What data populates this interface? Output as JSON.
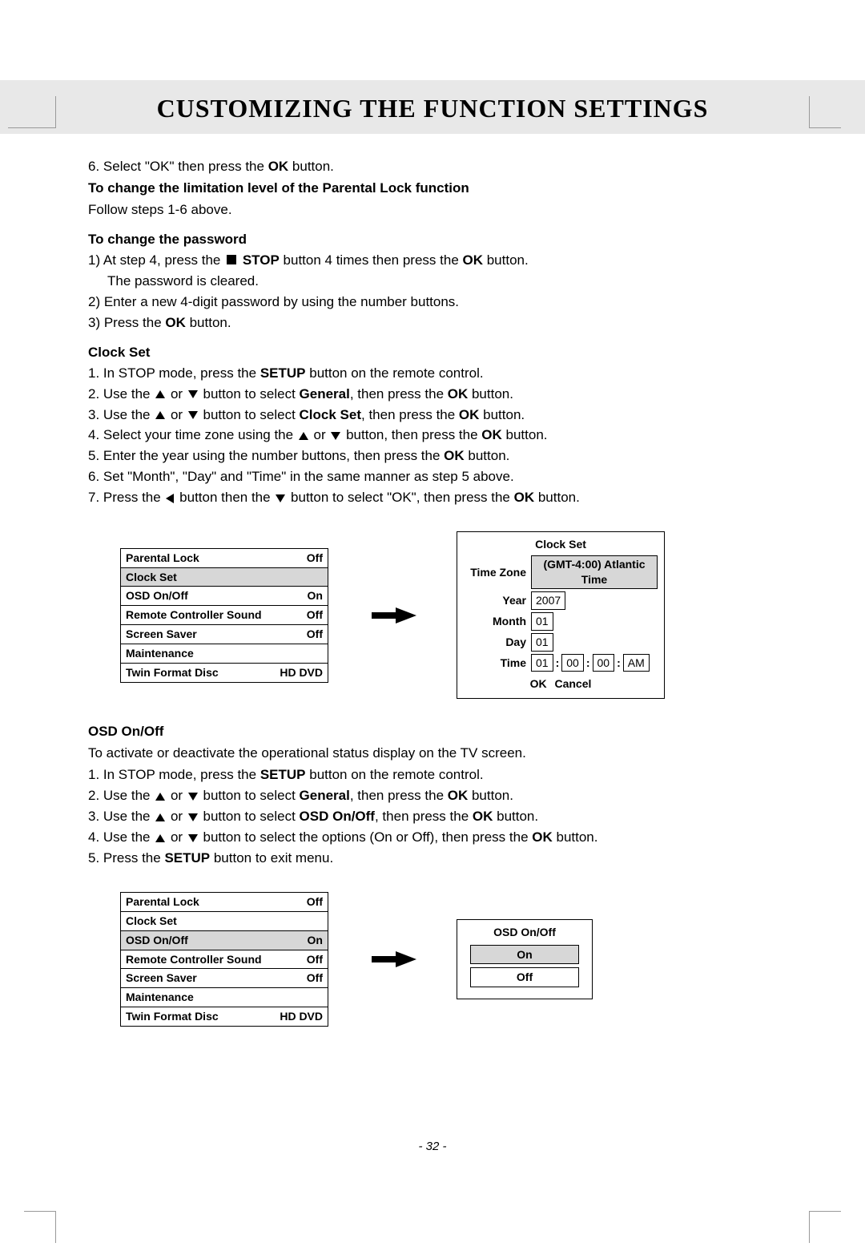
{
  "title": "CUSTOMIZING THE FUNCTION SETTINGS",
  "page_number": "- 32 -",
  "intro": {
    "step6": "6. Select \"OK\" then press the ",
    "step6_bold": "OK",
    "step6_after": " button.",
    "line2_bold": "To change the limitation level of the Parental Lock function",
    "line3": "Follow steps 1-6 above."
  },
  "pw": {
    "head": "To change the password",
    "s1_a": "1)  At step 4, press the ",
    "s1_b_stop": "STOP",
    "s1_c": " button 4 times then press the ",
    "s1_d_ok": "OK",
    "s1_e": " button.",
    "s1_line2": "The password is cleared.",
    "s2": "2)  Enter a new 4-digit password by using the number buttons.",
    "s3_a": "3)  Press the ",
    "s3_ok": "OK",
    "s3_b": " button."
  },
  "clock": {
    "head": "Clock Set",
    "s1_a": "1. In STOP mode, press the ",
    "s1_setup": "SETUP",
    "s1_b": " button on the remote control.",
    "s2_a": "2. Use the ",
    "s2_b": " or ",
    "s2_c": " button to select ",
    "s2_general": "General",
    "s2_d": ", then press the ",
    "s2_ok": "OK",
    "s2_e": " button.",
    "s3_a": "3. Use the ",
    "s3_b": " or ",
    "s3_c": " button to select ",
    "s3_cs": "Clock Set",
    "s3_d": ", then press the ",
    "s3_ok": "OK",
    "s3_e": " button.",
    "s4_a": "4. Select your time zone using the ",
    "s4_b": " or ",
    "s4_c": " button, then press the ",
    "s4_ok": "OK",
    "s4_d": " button.",
    "s5_a": "5. Enter the year using the number buttons, then press the ",
    "s5_ok": "OK",
    "s5_b": " button.",
    "s6": "6. Set \"Month\", \"Day\" and \"Time\" in the same manner as step 5 above.",
    "s7_a": "7. Press the ",
    "s7_b": " button then the ",
    "s7_c": " button to select \"OK\", then press the ",
    "s7_ok": "OK",
    "s7_d": " button."
  },
  "menu1": {
    "rows": [
      {
        "label": "Parental Lock",
        "value": "Off",
        "hl": false
      },
      {
        "label": "Clock Set",
        "value": "",
        "hl": true
      },
      {
        "label": "OSD On/Off",
        "value": "On",
        "hl": false
      },
      {
        "label": "Remote Controller Sound",
        "value": "Off",
        "hl": false
      },
      {
        "label": "Screen Saver",
        "value": "Off",
        "hl": false
      },
      {
        "label": "Maintenance",
        "value": "",
        "hl": false
      },
      {
        "label": "Twin Format Disc",
        "value": "HD DVD",
        "hl": false
      }
    ]
  },
  "clock_panel": {
    "title": "Clock Set",
    "tz_label": "Time Zone",
    "tz_value": "(GMT-4:00) Atlantic Time",
    "year_label": "Year",
    "year_value": "2007",
    "month_label": "Month",
    "month_value": "01",
    "day_label": "Day",
    "day_value": "01",
    "time_label": "Time",
    "time_h": "01",
    "time_m": "00",
    "time_s": "00",
    "time_ampm": "AM",
    "btn_ok": "OK",
    "btn_cancel": "Cancel"
  },
  "osd": {
    "head": "OSD On/Off",
    "desc": "To activate or deactivate the operational status display on the TV screen.",
    "s1_a": "1. In STOP mode, press the ",
    "s1_setup": "SETUP",
    "s1_b": " button on the remote control.",
    "s2_a": "2. Use the ",
    "s2_b": " or ",
    "s2_c": " button to select ",
    "s2_general": "General",
    "s2_d": ", then press the ",
    "s2_ok": "OK",
    "s2_e": " button.",
    "s3_a": "3. Use the ",
    "s3_b": " or ",
    "s3_c": " button to select ",
    "s3_osd": "OSD On/Off",
    "s3_d": ", then press the ",
    "s3_ok": "OK",
    "s3_e": " button.",
    "s4_a": "4. Use the ",
    "s4_b": " or ",
    "s4_c": " button to select the options (On or Off), then press the ",
    "s4_ok": "OK",
    "s4_d": " button.",
    "s5_a": "5. Press the ",
    "s5_setup": "SETUP",
    "s5_b": " button to exit menu."
  },
  "menu2": {
    "rows": [
      {
        "label": "Parental Lock",
        "value": "Off",
        "hl": false
      },
      {
        "label": "Clock Set",
        "value": "",
        "hl": false
      },
      {
        "label": "OSD On/Off",
        "value": "On",
        "hl": true
      },
      {
        "label": "Remote Controller Sound",
        "value": "Off",
        "hl": false
      },
      {
        "label": "Screen Saver",
        "value": "Off",
        "hl": false
      },
      {
        "label": "Maintenance",
        "value": "",
        "hl": false
      },
      {
        "label": "Twin Format Disc",
        "value": "HD DVD",
        "hl": false
      }
    ]
  },
  "osd_panel": {
    "title": "OSD On/Off",
    "opt_on": "On",
    "opt_off": "Off"
  }
}
